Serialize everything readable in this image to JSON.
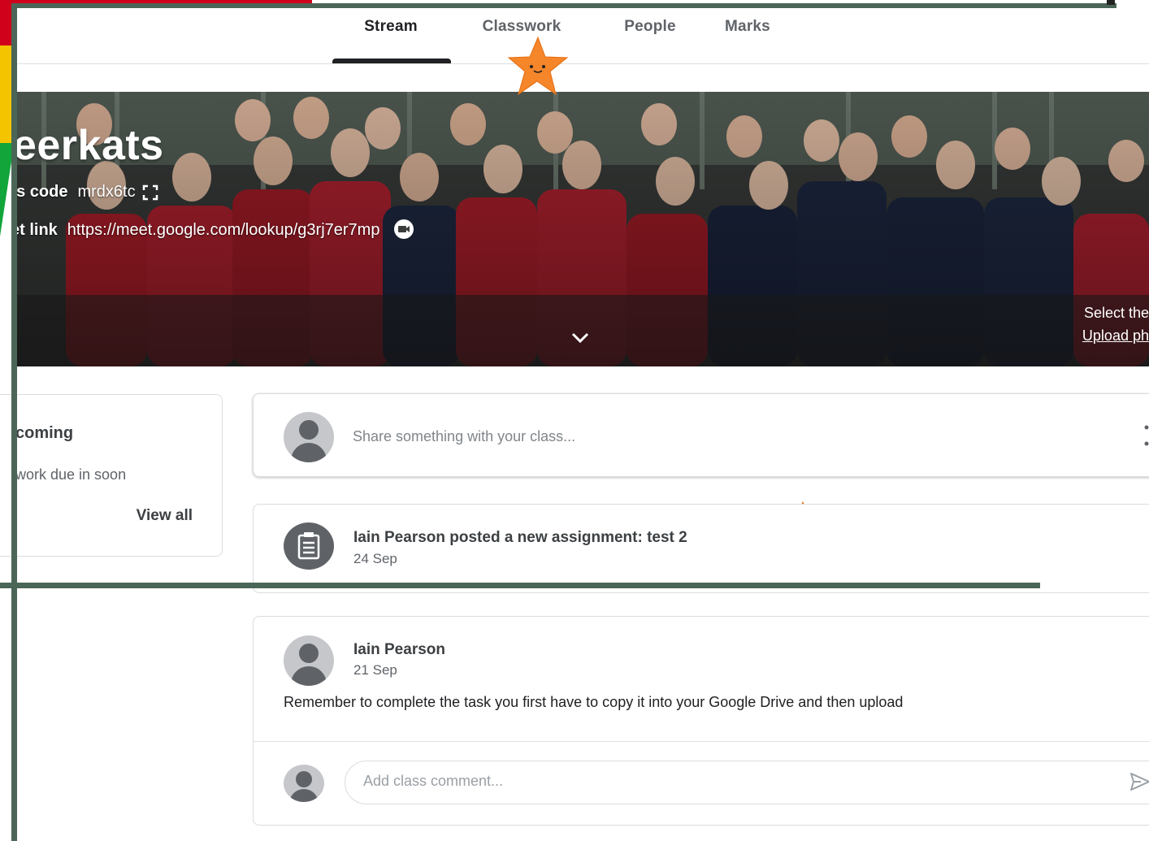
{
  "tabs": [
    {
      "label": "Stream",
      "active": true
    },
    {
      "label": "Classwork",
      "active": false
    },
    {
      "label": "People",
      "active": false
    },
    {
      "label": "Marks",
      "active": false
    }
  ],
  "banner": {
    "title": "leerkats",
    "class_code_label": "ss code",
    "class_code": "mrdx6tc",
    "meet_link_label": "et link",
    "meet_link": "https://meet.google.com/lookup/g3rj7er7mp",
    "select_text": "Select the",
    "upload_text": "Upload ph"
  },
  "upcoming": {
    "title": "coming",
    "text": "work due in soon",
    "view_all": "View all"
  },
  "share": {
    "placeholder": "Share something with your class..."
  },
  "assignment_post": {
    "title": "Iain Pearson posted a new assignment: test 2",
    "date": "24 Sep"
  },
  "post": {
    "author": "Iain Pearson",
    "date": "21 Sep",
    "text": "Remember to complete the task you first have to copy it into your Google Drive and then upload",
    "comment_placeholder": "Add class comment..."
  },
  "colors": {
    "frame": "#4b6657",
    "star": "#f5862a",
    "deco_red": "#d0021b",
    "deco_yellow": "#f5c400",
    "deco_green": "#11a53a"
  },
  "icons": [
    "fullscreen-icon",
    "video-call-icon",
    "chevron-down-icon",
    "avatar-icon",
    "assignment-icon",
    "more-vert-icon",
    "send-icon",
    "star-sticker"
  ]
}
